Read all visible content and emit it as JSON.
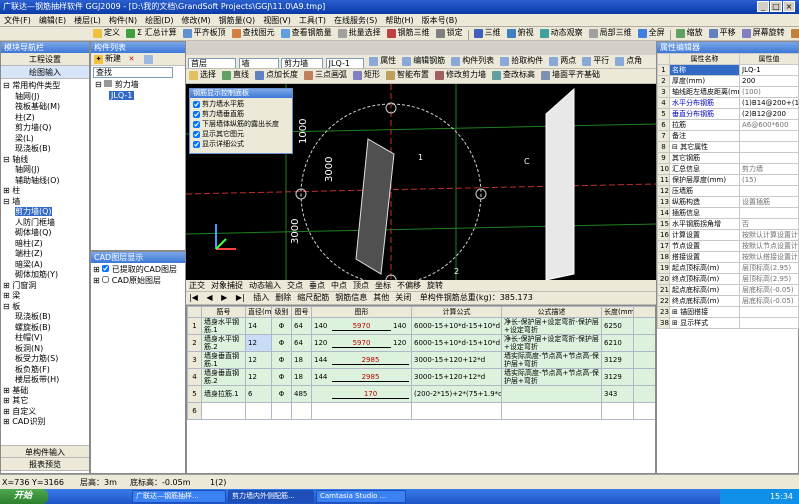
{
  "window": {
    "title": "广联达—钢筋抽样软件 GGJ2009 - [D:\\我的文档\\GrandSoft Projects\\GGJ\\11.0\\A9.tmp]"
  },
  "menu": [
    "文件(F)",
    "编辑(E)",
    "楼层(L)",
    "构件(N)",
    "绘图(D)",
    "修改(M)",
    "钢筋量(Q)",
    "视图(V)",
    "工具(T)",
    "在线服务(S)",
    "帮助(H)",
    "版本号(B)"
  ],
  "toolbar1": [
    "定义",
    "Σ 汇总计算",
    "平齐板顶",
    "查找图元",
    "查看钢筋量",
    "批量选择",
    "钢筋三维",
    "锁定",
    "三维",
    "俯视",
    "动态观察",
    "局部三维",
    "全屏",
    "缩放",
    "平移",
    "屏幕旋转",
    "选择楼层"
  ],
  "toolbar2": {
    "floor": "首层",
    "cat": "墙",
    "type": "剪力墙",
    "name": "JLQ-1",
    "items": [
      "属性",
      "编辑钢筋",
      "构件列表",
      "拾取构件",
      "两点",
      "平行",
      "点角"
    ]
  },
  "toolbar3": [
    "选择",
    "直线",
    "点加长度",
    "三点画弧",
    "矩形",
    "智能布置",
    "修改剪力墙",
    "查改标高",
    "墙面平齐基础"
  ],
  "nav": {
    "header": "模块导航栏",
    "btn1": "工程设置",
    "btn2": "绘图输入",
    "bottom1": "单构件输入",
    "bottom2": "报表预览",
    "tree": [
      {
        "t": "⊟ 常用构件类型",
        "d": 0
      },
      {
        "t": "轴网(J)",
        "d": 2
      },
      {
        "t": "筏板基础(M)",
        "d": 2
      },
      {
        "t": "柱(Z)",
        "d": 2
      },
      {
        "t": "剪力墙(Q)",
        "d": 2
      },
      {
        "t": "梁(L)",
        "d": 2
      },
      {
        "t": "现浇板(B)",
        "d": 2
      },
      {
        "t": "⊟ 轴线",
        "d": 0
      },
      {
        "t": "轴网(J)",
        "d": 2
      },
      {
        "t": "辅助轴线(O)",
        "d": 2
      },
      {
        "t": "⊞ 柱",
        "d": 0
      },
      {
        "t": "⊟ 墙",
        "d": 0
      },
      {
        "t": "剪力墙(Q)",
        "d": 2,
        "sel": true
      },
      {
        "t": "人防门框墙",
        "d": 2
      },
      {
        "t": "砌体墙(Q)",
        "d": 2
      },
      {
        "t": "暗柱(Z)",
        "d": 2
      },
      {
        "t": "端柱(Z)",
        "d": 2
      },
      {
        "t": "暗梁(A)",
        "d": 2
      },
      {
        "t": "砌体加筋(Y)",
        "d": 2
      },
      {
        "t": "⊞ 门窗洞",
        "d": 0
      },
      {
        "t": "⊞ 梁",
        "d": 0
      },
      {
        "t": "⊟ 板",
        "d": 0
      },
      {
        "t": "现浇板(B)",
        "d": 2
      },
      {
        "t": "螺旋板(B)",
        "d": 2
      },
      {
        "t": "柱帽(V)",
        "d": 2
      },
      {
        "t": "板洞(N)",
        "d": 2
      },
      {
        "t": "板受力筋(S)",
        "d": 2
      },
      {
        "t": "板负筋(F)",
        "d": 2
      },
      {
        "t": "楼层板带(H)",
        "d": 2
      },
      {
        "t": "⊞ 基础",
        "d": 0
      },
      {
        "t": "⊞ 其它",
        "d": 0
      },
      {
        "t": "⊞ 自定义",
        "d": 0
      },
      {
        "t": "⊞ CAD识别",
        "d": 0
      }
    ]
  },
  "complist": {
    "header": "构件列表",
    "new": "新建",
    "search": "查找",
    "root": "剪力墙",
    "item": "JLQ-1"
  },
  "cad": {
    "header": "CAD图层显示",
    "l1": "已提取的CAD图层",
    "l2": "CAD原始图层"
  },
  "popup": {
    "title": "钢筋显示控制面板",
    "items": [
      "剪力墙水平筋",
      "剪力墙垂直筋",
      "下层墙体纵筋的露出长度",
      "显示其它图元",
      "显示详细公式"
    ]
  },
  "viewport": {
    "dims": [
      "1000",
      "3000",
      "1000",
      "3000",
      "3000"
    ],
    "axes": [
      "1",
      "2",
      "C",
      "B"
    ]
  },
  "gridtb": {
    "row1": [
      "正交",
      "对象捕捉",
      "动态输入",
      "交点",
      "垂点",
      "中点",
      "顶点",
      "坐标",
      "不偏移",
      "旋转"
    ],
    "row2": [
      "插入",
      "删除",
      "缩尺配筋",
      "钢筋信息",
      "其他",
      "关闭"
    ],
    "total": "单构件钢筋总重(kg)：385.173"
  },
  "rebar": {
    "headers": [
      "筋号",
      "直径(mm)",
      "级别",
      "图号",
      "图形",
      "计算公式",
      "公式描述",
      "长度(mm)"
    ],
    "rows": [
      {
        "n": "1",
        "name": "墙身水平钢筋.1",
        "d": "14",
        "g": "Φ",
        "fig": "64",
        "a": "140",
        "mid": "5970",
        "b": "140",
        "f": "6000-15+10*d-15+10*d",
        "desc": "净长-保护层+设定弯折-保护层+设定弯折",
        "len": "6250"
      },
      {
        "n": "2",
        "name": "墙身水平钢筋.2",
        "d": "12",
        "g": "Φ",
        "fig": "64",
        "a": "120",
        "mid": "5970",
        "b": "120",
        "f": "6000-15+10*d-15+10*d",
        "desc": "净长-保护层+设定弯折-保护层+设定弯折",
        "len": "6210"
      },
      {
        "n": "3",
        "name": "墙身垂直钢筋.1",
        "d": "12",
        "g": "Φ",
        "fig": "18",
        "a": "144",
        "mid": "2985",
        "b": "",
        "f": "3000-15+120+12*d",
        "desc": "墙实际高度-节点高+节点高-保护层+弯折",
        "len": "3129"
      },
      {
        "n": "4",
        "name": "墙身垂直钢筋.2",
        "d": "12",
        "g": "Φ",
        "fig": "18",
        "a": "144",
        "mid": "2985",
        "b": "",
        "f": "3000-15+120+12*d",
        "desc": "墙实际高度-节点高+节点高-保护层+弯折",
        "len": "3129"
      },
      {
        "n": "5",
        "name": "墙身拉筋.1",
        "d": "6",
        "g": "Φ",
        "fig": "485",
        "a": "",
        "mid": "170",
        "b": "",
        "f": "(200-2*15)+2*(75+1.9*d)",
        "desc": "",
        "len": "343"
      },
      {
        "n": "6",
        "name": "",
        "d": "",
        "g": "",
        "fig": "",
        "a": "",
        "mid": "",
        "b": "",
        "f": "",
        "desc": "",
        "len": ""
      }
    ]
  },
  "props": {
    "header": "属性编辑器",
    "c1": "属性名称",
    "c2": "属性值",
    "rows": [
      {
        "n": "1",
        "k": "名称",
        "v": "JLQ-1",
        "hl": true
      },
      {
        "n": "2",
        "k": "厚度(mm)",
        "v": "200"
      },
      {
        "n": "3",
        "k": "轴线距左墙皮距离(mm)",
        "v": "(100)"
      },
      {
        "n": "4",
        "k": "水平分布钢筋",
        "v": "(1)B14@200+(1)B12",
        "hl": true
      },
      {
        "n": "5",
        "k": "垂直分布钢筋",
        "v": "(2)B12@200",
        "hl": true
      },
      {
        "n": "6",
        "k": "拉筋",
        "v": "A6@600*600"
      },
      {
        "n": "7",
        "k": "备注",
        "v": ""
      },
      {
        "n": "8",
        "k": "⊟ 其它属性",
        "v": ""
      },
      {
        "n": "9",
        "k": "其它钢筋",
        "v": ""
      },
      {
        "n": "10",
        "k": "汇总信息",
        "v": "剪力墙"
      },
      {
        "n": "11",
        "k": "保护层厚度(mm)",
        "v": "(15)"
      },
      {
        "n": "12",
        "k": "压墙筋",
        "v": ""
      },
      {
        "n": "13",
        "k": "纵筋构造",
        "v": "设置插筋"
      },
      {
        "n": "14",
        "k": "插筋信息",
        "v": ""
      },
      {
        "n": "15",
        "k": "水平钢筋拐角增",
        "v": "否"
      },
      {
        "n": "16",
        "k": "计算设置",
        "v": "按默认计算设置计"
      },
      {
        "n": "17",
        "k": "节点设置",
        "v": "按默认节点设置计"
      },
      {
        "n": "18",
        "k": "搭接设置",
        "v": "按默认搭接设置计"
      },
      {
        "n": "19",
        "k": "起点顶标高(m)",
        "v": "层顶标高(2.95)"
      },
      {
        "n": "20",
        "k": "终点顶标高(m)",
        "v": "层顶标高(2.95)"
      },
      {
        "n": "21",
        "k": "起点底标高(m)",
        "v": "层底标高(-0.05)"
      },
      {
        "n": "22",
        "k": "终点底标高(m)",
        "v": "层底标高(-0.05)"
      },
      {
        "n": "23",
        "k": "⊞ 锚固搭接",
        "v": ""
      },
      {
        "n": "38",
        "k": "⊞ 显示样式",
        "v": ""
      }
    ]
  },
  "status": {
    "coord": "X=736 Y=3166",
    "floor": "层高：3m",
    "bottom": "底标高：-0.05m",
    "sel": "1(2)"
  },
  "taskbar": {
    "start": "开始",
    "t1": "广联达—钢筋抽样...",
    "t2": "剪力墙内外侧配筋...",
    "t3": "Camtasia Studio ...",
    "time": "15:34"
  }
}
